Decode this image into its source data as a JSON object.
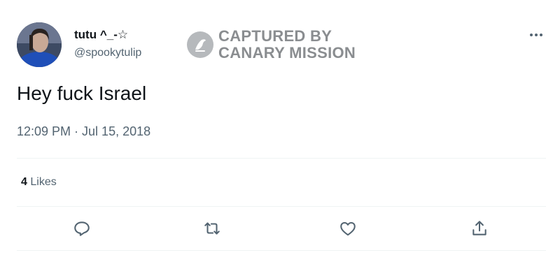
{
  "tweet": {
    "author": {
      "display_name": "tutu ^_-☆",
      "handle": "@spookytulip"
    },
    "text": "Hey fuck Israel",
    "timestamp": "12:09 PM · Jul 15, 2018",
    "likes": {
      "count": "4",
      "label": "Likes"
    }
  },
  "watermark": {
    "line1": "CAPTURED BY",
    "line2": "CANARY MISSION"
  },
  "icons": {
    "more": "more-dots-icon",
    "reply": "reply-icon",
    "retweet": "retweet-icon",
    "like": "like-icon",
    "share": "share-icon"
  },
  "colors": {
    "text_primary": "#0f1419",
    "text_secondary": "#536471",
    "divider": "#eff3f4",
    "watermark": "#8a8d90"
  }
}
